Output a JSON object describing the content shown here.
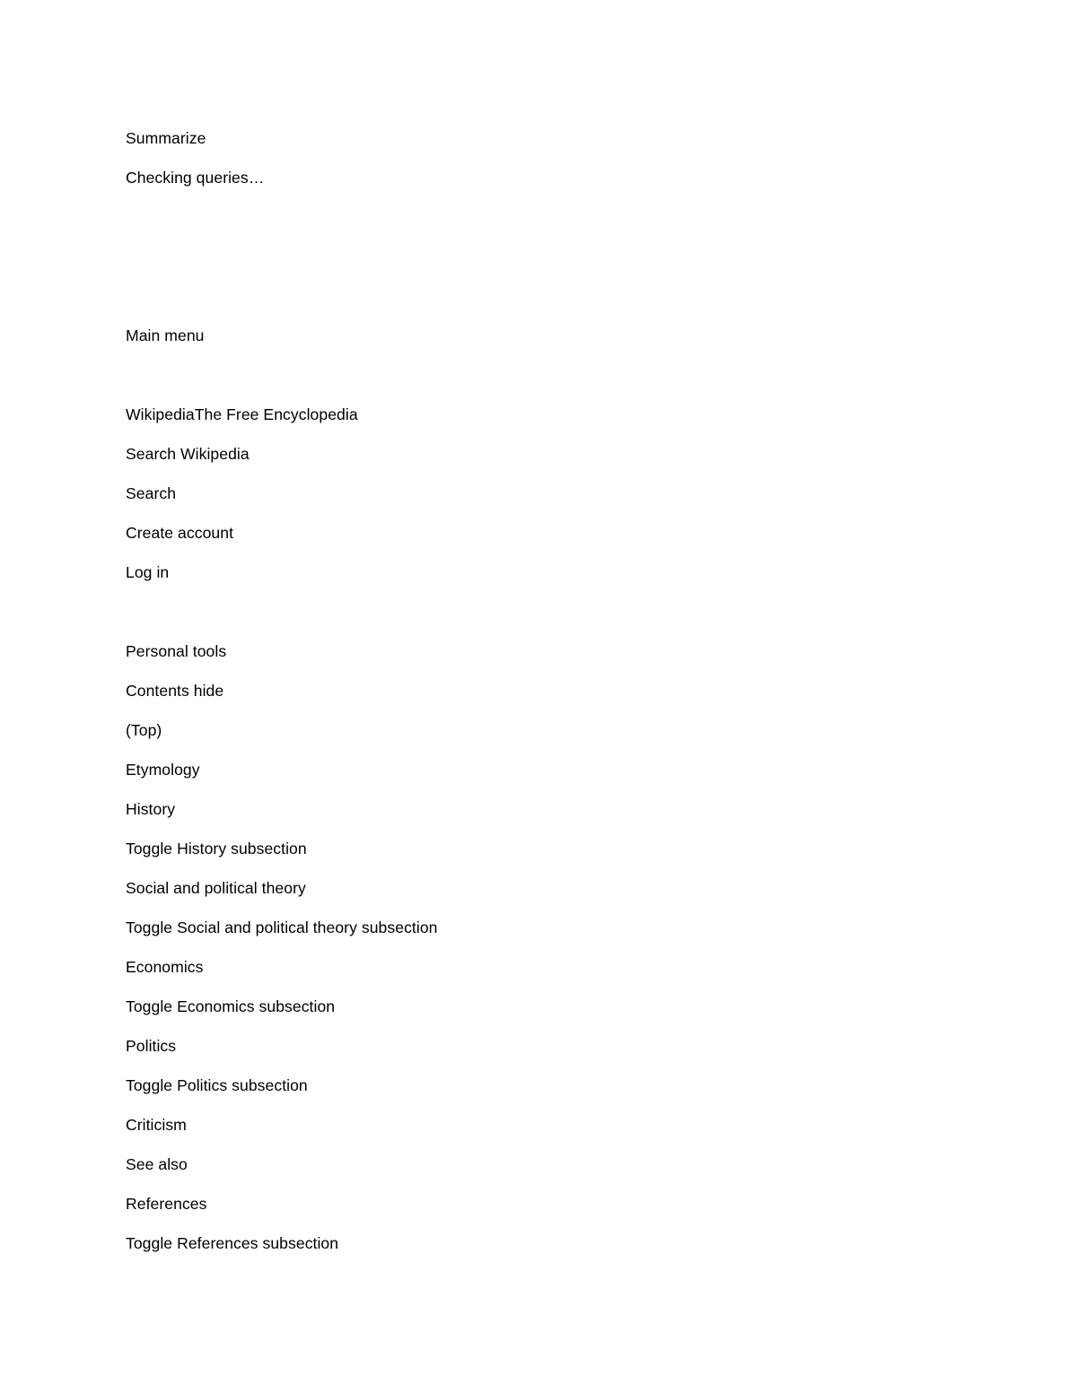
{
  "document": {
    "background_color": "#ffffff",
    "text_color": "#000000",
    "blocks": [
      {
        "id": "summarize",
        "text": "Summarize",
        "kind": "text"
      },
      {
        "id": "checking-queries",
        "text": "Checking queries…",
        "kind": "text"
      },
      {
        "id": "spacer-1",
        "text": "",
        "kind": "empty"
      },
      {
        "id": "spacer-2",
        "text": "",
        "kind": "empty"
      },
      {
        "id": "spacer-3",
        "text": "",
        "kind": "empty"
      },
      {
        "id": "main-menu",
        "text": "Main menu",
        "kind": "text"
      },
      {
        "id": "spacer-4",
        "text": "",
        "kind": "empty"
      },
      {
        "id": "wikipedia-tagline",
        "text": "WikipediaThe Free Encyclopedia",
        "kind": "text"
      },
      {
        "id": "search-wikipedia",
        "text": "Search Wikipedia",
        "kind": "text"
      },
      {
        "id": "search",
        "text": "Search",
        "kind": "text"
      },
      {
        "id": "create-account",
        "text": "Create account",
        "kind": "text"
      },
      {
        "id": "log-in",
        "text": "Log in",
        "kind": "text"
      },
      {
        "id": "spacer-5",
        "text": "",
        "kind": "empty"
      },
      {
        "id": "personal-tools",
        "text": "Personal tools",
        "kind": "text"
      },
      {
        "id": "contents-hide",
        "text": "Contents hide",
        "kind": "text"
      },
      {
        "id": "toc-top",
        "text": "(Top)",
        "kind": "text"
      },
      {
        "id": "toc-etymology",
        "text": "Etymology",
        "kind": "text"
      },
      {
        "id": "toc-history",
        "text": "History",
        "kind": "text"
      },
      {
        "id": "toggle-history",
        "text": "Toggle History subsection",
        "kind": "text"
      },
      {
        "id": "toc-social-political",
        "text": "Social and political theory",
        "kind": "text"
      },
      {
        "id": "toggle-social-political",
        "text": "Toggle Social and political theory subsection",
        "kind": "text"
      },
      {
        "id": "toc-economics",
        "text": "Economics",
        "kind": "text"
      },
      {
        "id": "toggle-economics",
        "text": "Toggle Economics subsection",
        "kind": "text"
      },
      {
        "id": "toc-politics",
        "text": "Politics",
        "kind": "text"
      },
      {
        "id": "toggle-politics",
        "text": "Toggle Politics subsection",
        "kind": "text"
      },
      {
        "id": "toc-criticism",
        "text": "Criticism",
        "kind": "text"
      },
      {
        "id": "toc-see-also",
        "text": "See also",
        "kind": "text"
      },
      {
        "id": "toc-references",
        "text": "References",
        "kind": "text"
      },
      {
        "id": "toggle-references",
        "text": "Toggle References subsection",
        "kind": "text"
      }
    ]
  }
}
